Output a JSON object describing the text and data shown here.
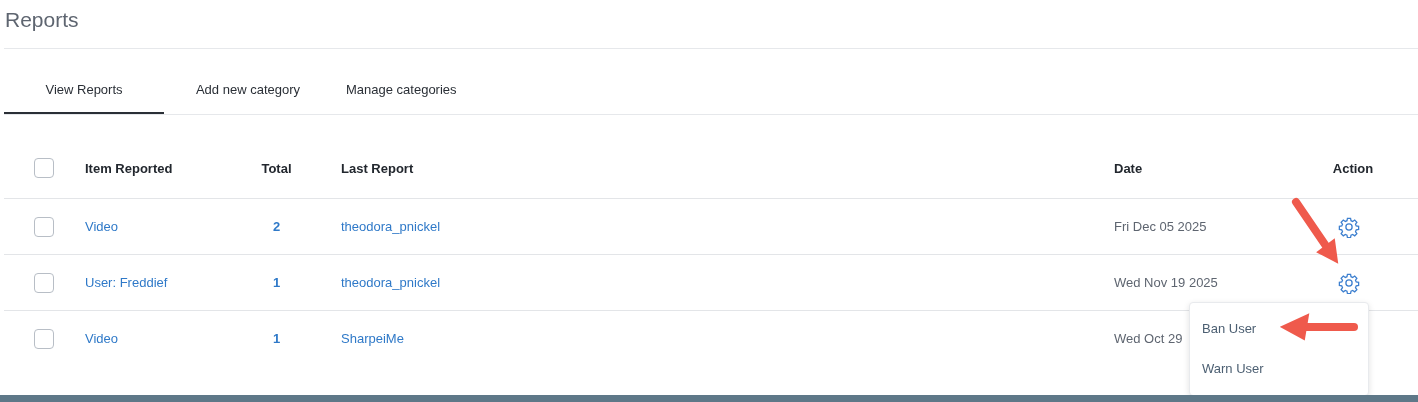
{
  "page": {
    "title": "Reports"
  },
  "tabs": [
    {
      "label": "View Reports",
      "selected": true
    },
    {
      "label": "Add new category",
      "selected": false
    },
    {
      "label": "Manage categories",
      "selected": false
    }
  ],
  "table": {
    "select_all": {
      "checked": false
    },
    "columns": [
      "Item Reported",
      "Total",
      "Last Report",
      "Date",
      "Action"
    ],
    "rows": [
      {
        "checked": false,
        "item": "Video",
        "total": "2",
        "last_report": "theodora_pnickel",
        "date": "Fri Dec 05 2025"
      },
      {
        "checked": false,
        "item": "User: Freddief",
        "total": "1",
        "last_report": "theodora_pnickel",
        "date": "Wed Nov 19 2025"
      },
      {
        "checked": false,
        "item": "Video",
        "total": "1",
        "last_report": "SharpeiMe",
        "date": "Wed Oct 29"
      }
    ]
  },
  "action_menu": {
    "items": [
      "Ban User",
      "Warn User"
    ]
  }
}
